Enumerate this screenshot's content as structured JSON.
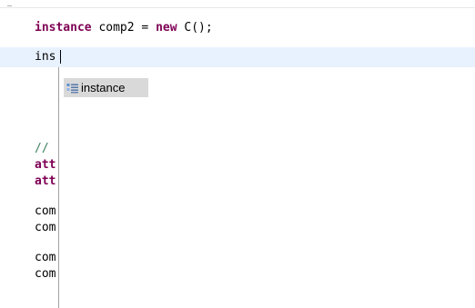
{
  "editor": {
    "line1": {
      "type_name": "instance",
      "middle": " comp2 = ",
      "new_kw": "new",
      "rest": " C();"
    },
    "line2_text": "ins",
    "partial_lines": [
      {
        "text": "//",
        "style": "comment"
      },
      {
        "text": "att",
        "style": "kw"
      },
      {
        "text": "att",
        "style": "kw"
      },
      {
        "text": "com",
        "style": "plain"
      },
      {
        "text": "com",
        "style": "plain"
      },
      {
        "text": "com",
        "style": "plain"
      },
      {
        "text": "com",
        "style": "plain"
      }
    ]
  },
  "autocomplete": {
    "items": [
      {
        "label": "instance",
        "icon": "type-proposal-icon"
      }
    ]
  },
  "colors": {
    "keyword": "#7f0055",
    "comment": "#3f7f5f",
    "current_line": "#e8f2fe",
    "selection": "#d9d9d9"
  }
}
